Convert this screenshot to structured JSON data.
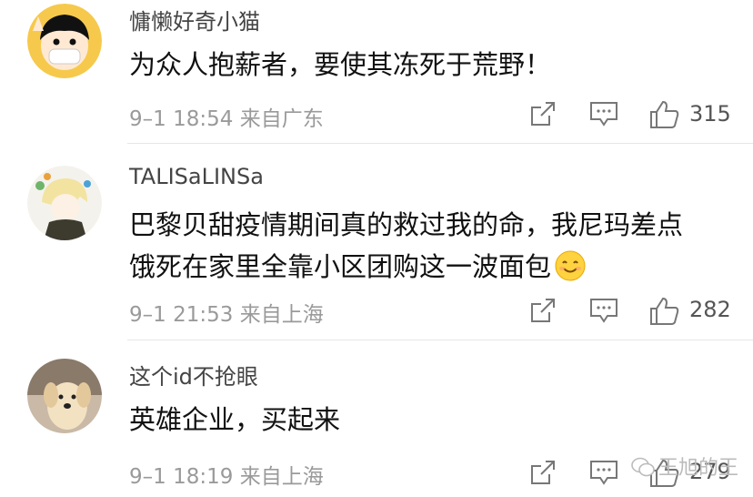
{
  "comments": [
    {
      "username": "慵懒好奇小猫",
      "text_lines": [
        "为众人抱薪者，要使其冻死于荒野！"
      ],
      "time": "9–1 18:54",
      "location": "来自广东",
      "likes": "315",
      "avatar_icon": "cartoon-boy-avatar-icon"
    },
    {
      "username": "TALISaLINSa",
      "text_lines": [
        "巴黎贝甜疫情期间真的救过我的命，我尼玛差点",
        "饿死在家里全靠小区团购这一波面包"
      ],
      "time": "9–1 21:53",
      "location": "来自上海",
      "likes": "282",
      "avatar_icon": "anime-character-avatar-icon",
      "emoji": "smiling-face-emoji-icon"
    },
    {
      "username": "这个id不抢眼",
      "text_lines": [
        "英雄企业，买起来"
      ],
      "time": "9–1 18:19",
      "location": "来自上海",
      "likes": "279",
      "avatar_icon": "puppy-avatar-icon"
    }
  ],
  "watermark": {
    "text": "王旭的王"
  },
  "colors": {
    "meta": "#9a9a9a",
    "text": "#111111",
    "divider": "#e6e6e6"
  }
}
